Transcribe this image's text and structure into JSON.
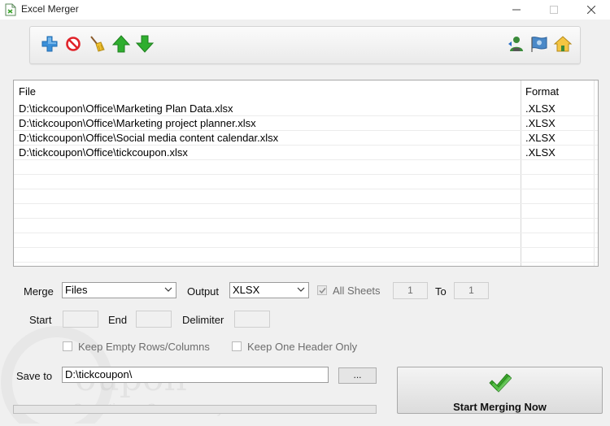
{
  "window": {
    "title": "Excel Merger"
  },
  "toolbar": {
    "left": [
      "add-icon",
      "remove-icon",
      "clear-icon",
      "move-up-icon",
      "move-down-icon"
    ],
    "right": [
      "user-icon",
      "flag-icon",
      "home-icon"
    ]
  },
  "file_list": {
    "columns": {
      "file": "File",
      "format": "Format"
    },
    "rows": [
      {
        "file": "D:\\tickcoupon\\Office\\Marketing Plan Data.xlsx",
        "format": ".XLSX"
      },
      {
        "file": "D:\\tickcoupon\\Office\\Marketing project planner.xlsx",
        "format": ".XLSX"
      },
      {
        "file": "D:\\tickcoupon\\Office\\Social media content calendar.xlsx",
        "format": ".XLSX"
      },
      {
        "file": "D:\\tickcoupon\\Office\\tickcoupon.xlsx",
        "format": ".XLSX"
      }
    ]
  },
  "options": {
    "merge_label": "Merge",
    "merge_value": "Files",
    "output_label": "Output",
    "output_value": "XLSX",
    "all_sheets_label": "All Sheets",
    "all_sheets_checked": true,
    "from_value": "1",
    "to_label": "To",
    "to_value": "1",
    "start_label": "Start",
    "start_value": "",
    "end_label": "End",
    "end_value": "",
    "delimiter_label": "Delimiter",
    "delimiter_value": "",
    "keep_empty_label": "Keep Empty Rows/Columns",
    "keep_empty_checked": false,
    "keep_header_label": "Keep One Header Only",
    "keep_header_checked": false
  },
  "save": {
    "label": "Save to",
    "path": "D:\\tickcoupon\\",
    "browse_label": "..."
  },
  "progress": {
    "value": 0
  },
  "actions": {
    "start_label": "Start Merging Now"
  },
  "watermark": {
    "brand": "oupon",
    "tagline": "Save time - Save money"
  },
  "colors": {
    "accent_green": "#3aa32b",
    "progress_green": "#06b025"
  }
}
